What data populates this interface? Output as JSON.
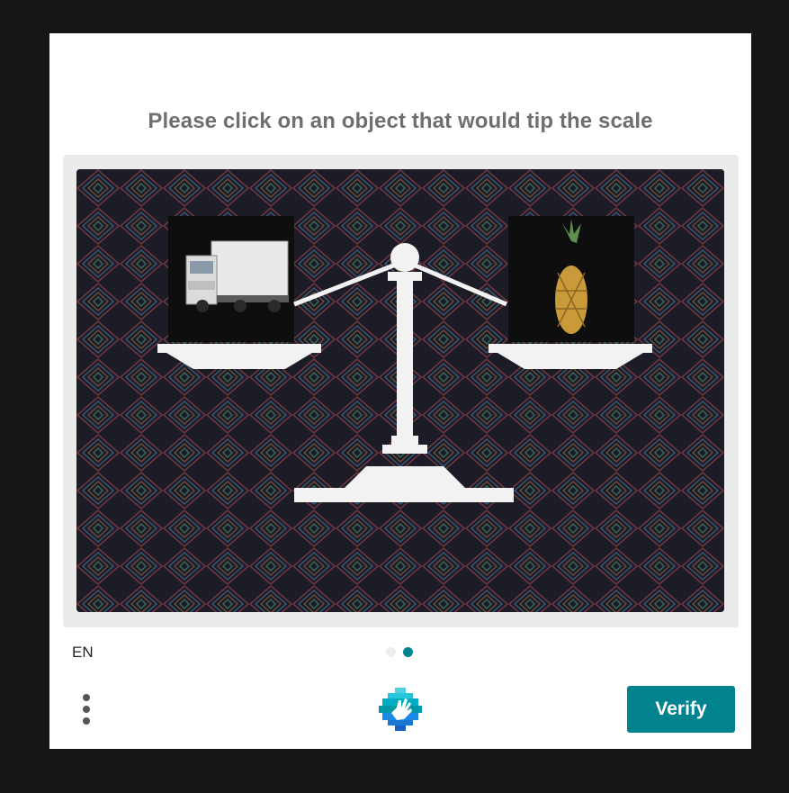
{
  "challenge": {
    "prompt": "Please click on an object that would tip the scale",
    "image_objects": [
      "truck",
      "pineapple",
      "balance-scale"
    ],
    "pages_total": 2,
    "current_page": 2
  },
  "footer": {
    "language": "EN",
    "verify_label": "Verify"
  },
  "colors": {
    "accent": "#00838f",
    "prompt_text": "#6f6f6f",
    "overlay": "#161616"
  }
}
